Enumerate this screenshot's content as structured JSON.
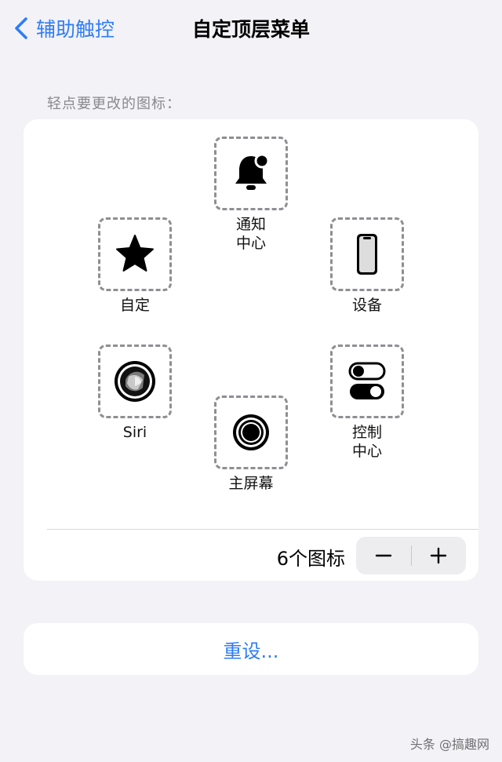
{
  "nav": {
    "back_label": "辅助触控",
    "title": "自定顶层菜单"
  },
  "section": {
    "label": "轻点要更改的图标："
  },
  "icons": [
    {
      "label": "通知\n中心",
      "icon": "bell-icon"
    },
    {
      "label": "自定",
      "icon": "star-icon"
    },
    {
      "label": "设备",
      "icon": "phone-device-icon"
    },
    {
      "label": "Siri",
      "icon": "siri-icon"
    },
    {
      "label": "控制\n中心",
      "icon": "toggles-icon"
    },
    {
      "label": "主屏幕",
      "icon": "home-button-icon"
    }
  ],
  "footer": {
    "count_label": "6个图标",
    "minus": "−",
    "plus": "+"
  },
  "reset": {
    "label": "重设..."
  },
  "watermark": {
    "text": "头条 @搞趣网"
  },
  "colors": {
    "accent": "#2f7df6",
    "background": "#f2f2f7",
    "card": "#ffffff",
    "dashed": "#8e8e93"
  }
}
